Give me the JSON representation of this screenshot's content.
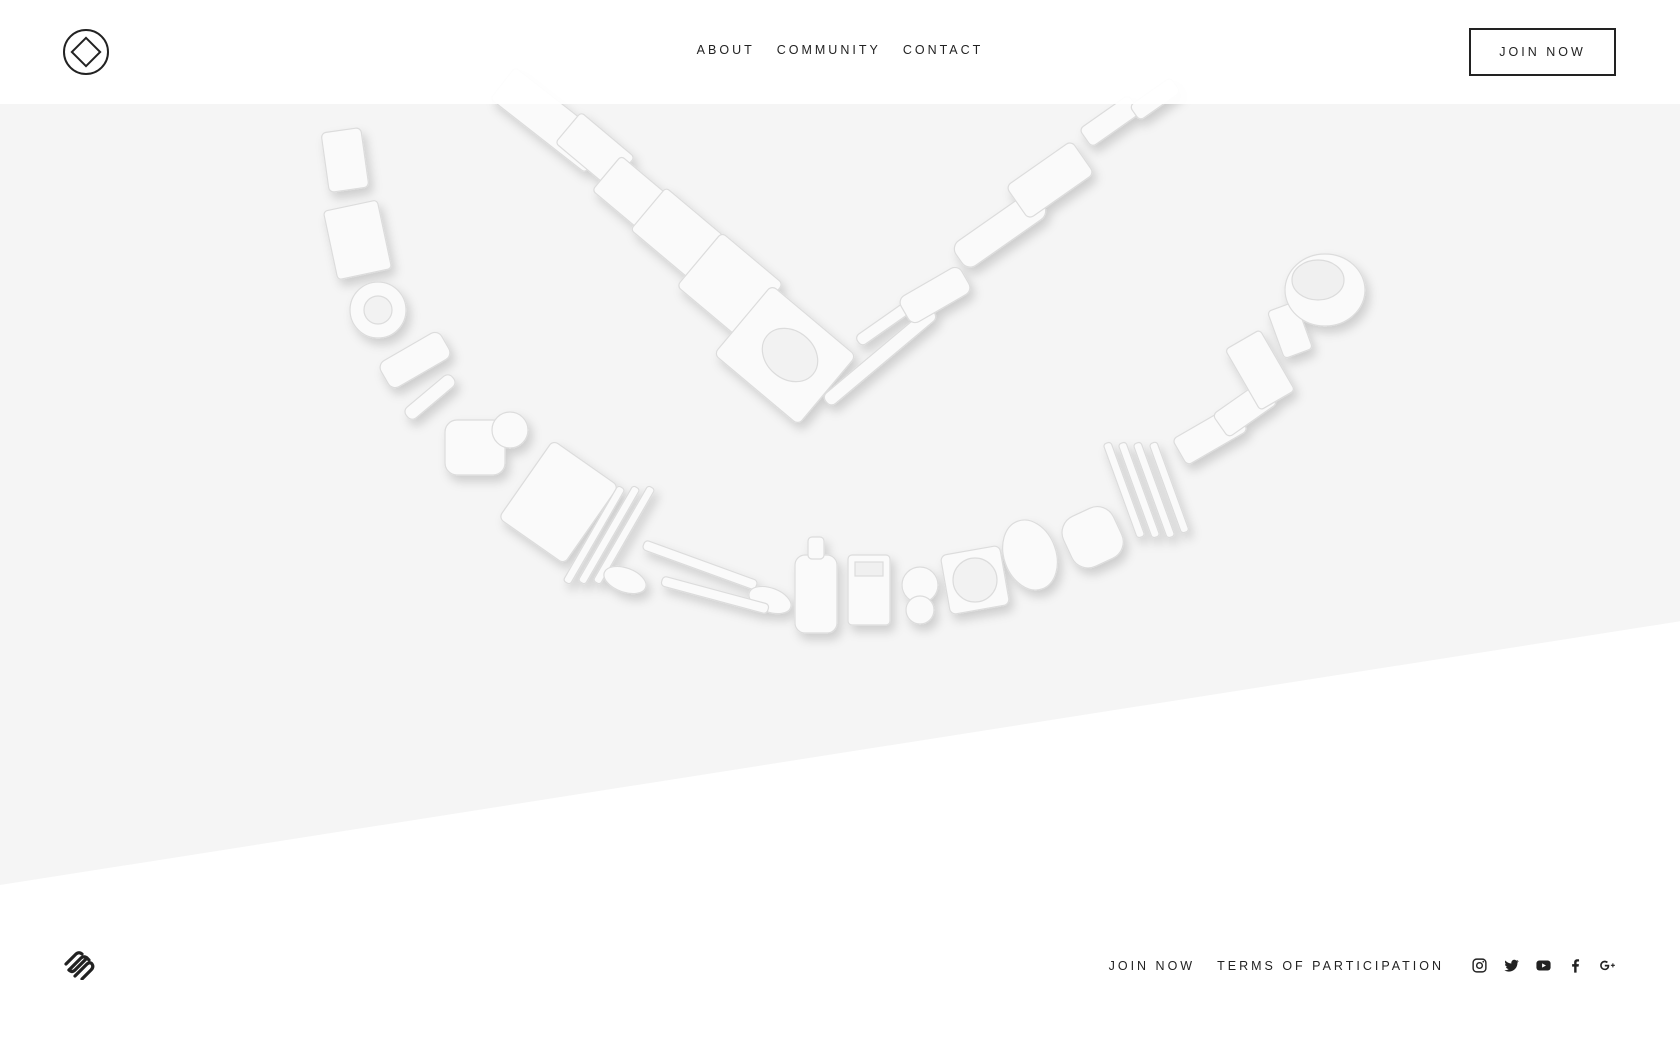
{
  "header": {
    "logo_icon": "diamond-in-circle-logo",
    "nav": [
      {
        "label": "ABOUT"
      },
      {
        "label": "COMMUNITY"
      },
      {
        "label": "CONTACT"
      }
    ],
    "join_label": "JOIN NOW"
  },
  "hero": {
    "image_description_icon": "hand-tools-arrangement-image"
  },
  "footer": {
    "logo_icon": "squarespace-logo",
    "links": [
      {
        "label": "JOIN NOW"
      },
      {
        "label": "TERMS OF PARTICIPATION"
      }
    ],
    "social_icons": [
      "instagram-icon",
      "twitter-icon",
      "youtube-icon",
      "facebook-icon",
      "google-plus-icon"
    ]
  },
  "colors": {
    "text": "#222222",
    "hero_bg": "#f5f5f5",
    "page_bg": "#ffffff"
  }
}
